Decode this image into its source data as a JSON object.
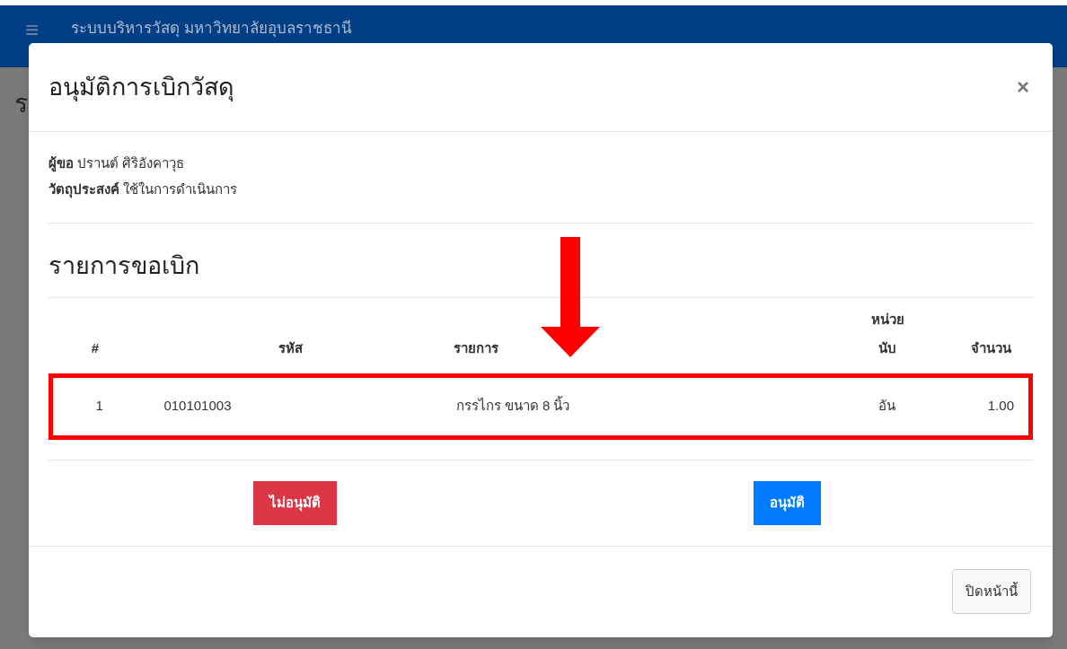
{
  "navbar": {
    "menu_icon": "≡",
    "title": "ระบบบริหารวัสดุ มหาวิทยาลัยอุบลราชธานี"
  },
  "page_heading": "ร",
  "modal": {
    "title": "อนุมัติการเบิกวัสดุ",
    "close": "×",
    "details": [
      {
        "label": "ผู้ขอ",
        "value": "ปรานต์ ศิริอังคาวุธ"
      },
      {
        "label": "วัตถุประสงค์",
        "value": "ใช้ในการดำเนินการ"
      }
    ],
    "section_title": "รายการขอเบิก",
    "table": {
      "columns": [
        "#",
        "รหัส",
        "รายการ",
        "หน่วย นับ",
        "จำนวน"
      ],
      "rows": [
        {
          "cells": [
            "1",
            "010101003",
            "กรรไกร ขนาด 8 นิ้ว",
            "อัน",
            "1.00"
          ],
          "highlighted": true
        }
      ]
    },
    "actions": [
      {
        "label": "ไม่อนุมัติ",
        "kind": "reject"
      },
      {
        "label": "อนุมัติ",
        "kind": "approve"
      }
    ],
    "footer_button": "ปิดหน้านี้"
  }
}
